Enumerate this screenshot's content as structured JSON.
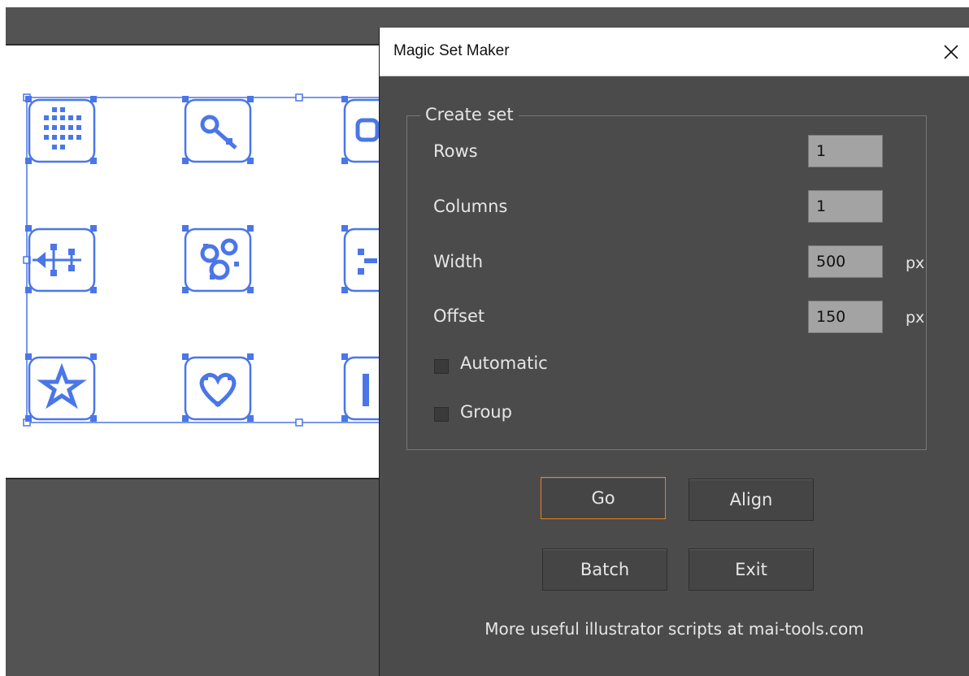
{
  "dialog": {
    "title": "Magic Set Maker",
    "group_title": "Create set",
    "rows_label": "Rows",
    "rows_value": "1",
    "columns_label": "Columns",
    "columns_value": "1",
    "width_label": "Width",
    "width_value": "500",
    "width_unit": "px",
    "offset_label": "Offset",
    "offset_value": "150",
    "offset_unit": "px",
    "automatic_label": "Automatic",
    "automatic_checked": false,
    "group_label": "Group",
    "group_checked": false,
    "go_label": "Go",
    "align_label": "Align",
    "batch_label": "Batch",
    "exit_label": "Exit",
    "footer": "More useful illustrator scripts at mai-tools.com"
  },
  "canvas": {
    "selection_color": "#4a76e8",
    "icons": [
      "grid-dots-icon",
      "key-icon",
      "partial-icon",
      "arrow-network-icon",
      "gear-cluster-icon",
      "partial-icon",
      "star-icon",
      "heart-icon",
      "partial-icon"
    ]
  }
}
